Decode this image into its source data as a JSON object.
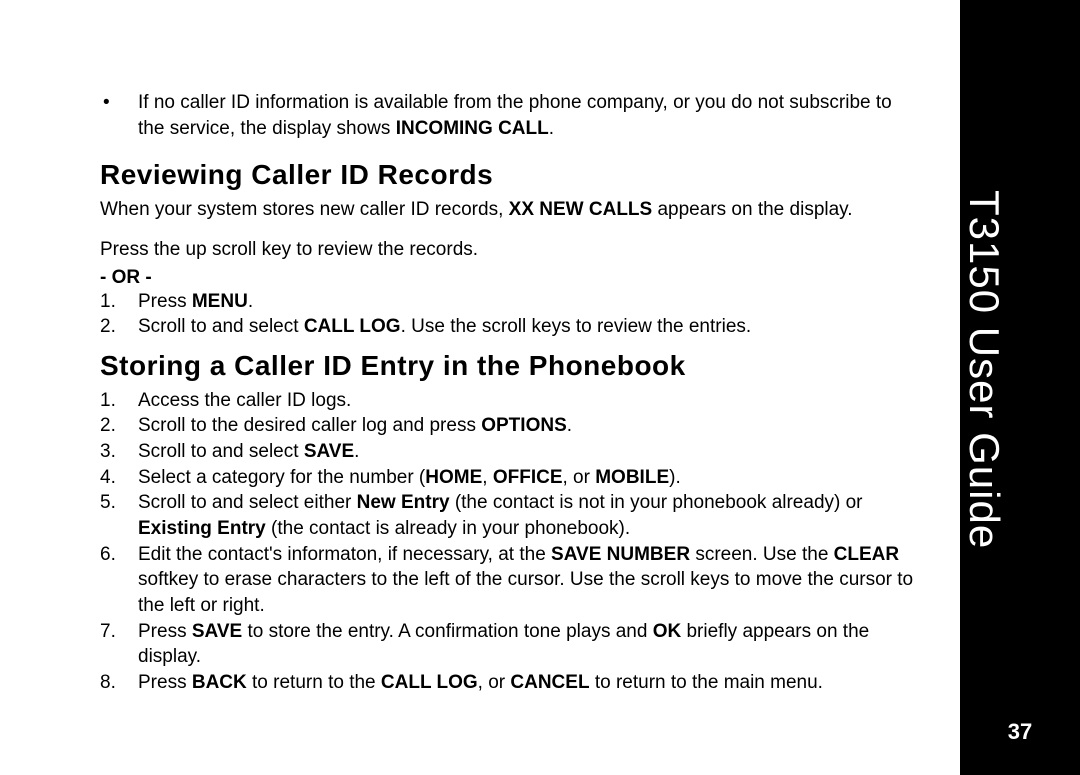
{
  "sidebar": {
    "title": "T3150 User Guide",
    "page_num": "37"
  },
  "intro_bullet": {
    "text_a": "If no caller ID information is available from the phone company, or you do not subscribe to the service, the display shows ",
    "bold_a": "INCOMING CALL",
    "text_b": "."
  },
  "sec1": {
    "heading": "Reviewing Caller ID Records",
    "para_a1": "When your system stores new caller ID records, ",
    "para_a_bold": "XX NEW CALLS",
    "para_a2": " appears on the display.",
    "para_b": "Press the up scroll key to review the records.",
    "or": "- OR -",
    "items": [
      {
        "a": "Press ",
        "b": "MENU",
        "c": "."
      },
      {
        "a": "Scroll to and select ",
        "b": "CALL LOG",
        "c": ". Use the scroll keys to review the entries."
      }
    ]
  },
  "sec2": {
    "heading": "Storing a Caller ID Entry in the Phonebook",
    "items": [
      {
        "a": "Access the caller ID logs."
      },
      {
        "a": "Scroll to the desired caller log and press ",
        "b": "OPTIONS",
        "c": "."
      },
      {
        "a": "Scroll to and select ",
        "b": "SAVE",
        "c": "."
      },
      {
        "a": "Select a category for the number (",
        "b": "HOME",
        "c": ", ",
        "d": "OFFICE",
        "e": ", or ",
        "f": "MOBILE",
        "g": ")."
      },
      {
        "a": "Scroll to and select either ",
        "b": "New Entry",
        "c": " (the contact is not in your phonebook already) or ",
        "d": "Existing Entry",
        "e": " (the contact is already in your phonebook)."
      },
      {
        "a": "Edit the contact's informaton, if necessary, at the ",
        "b": "SAVE NUMBER",
        "c": " screen. Use the ",
        "d": "CLEAR",
        "e": " softkey to erase characters to the left of the cursor. Use the scroll keys to move the cursor to the left or right."
      },
      {
        "a": "Press ",
        "b": "SAVE",
        "c": " to store the entry. A confirmation tone plays and ",
        "d": "OK",
        "e": " briefly appears on the display."
      },
      {
        "a": "Press ",
        "b": "BACK",
        "c": " to return to the ",
        "d": "CALL LOG",
        "e": ", or ",
        "f": "CANCEL",
        "g": " to return to the main menu."
      }
    ]
  }
}
